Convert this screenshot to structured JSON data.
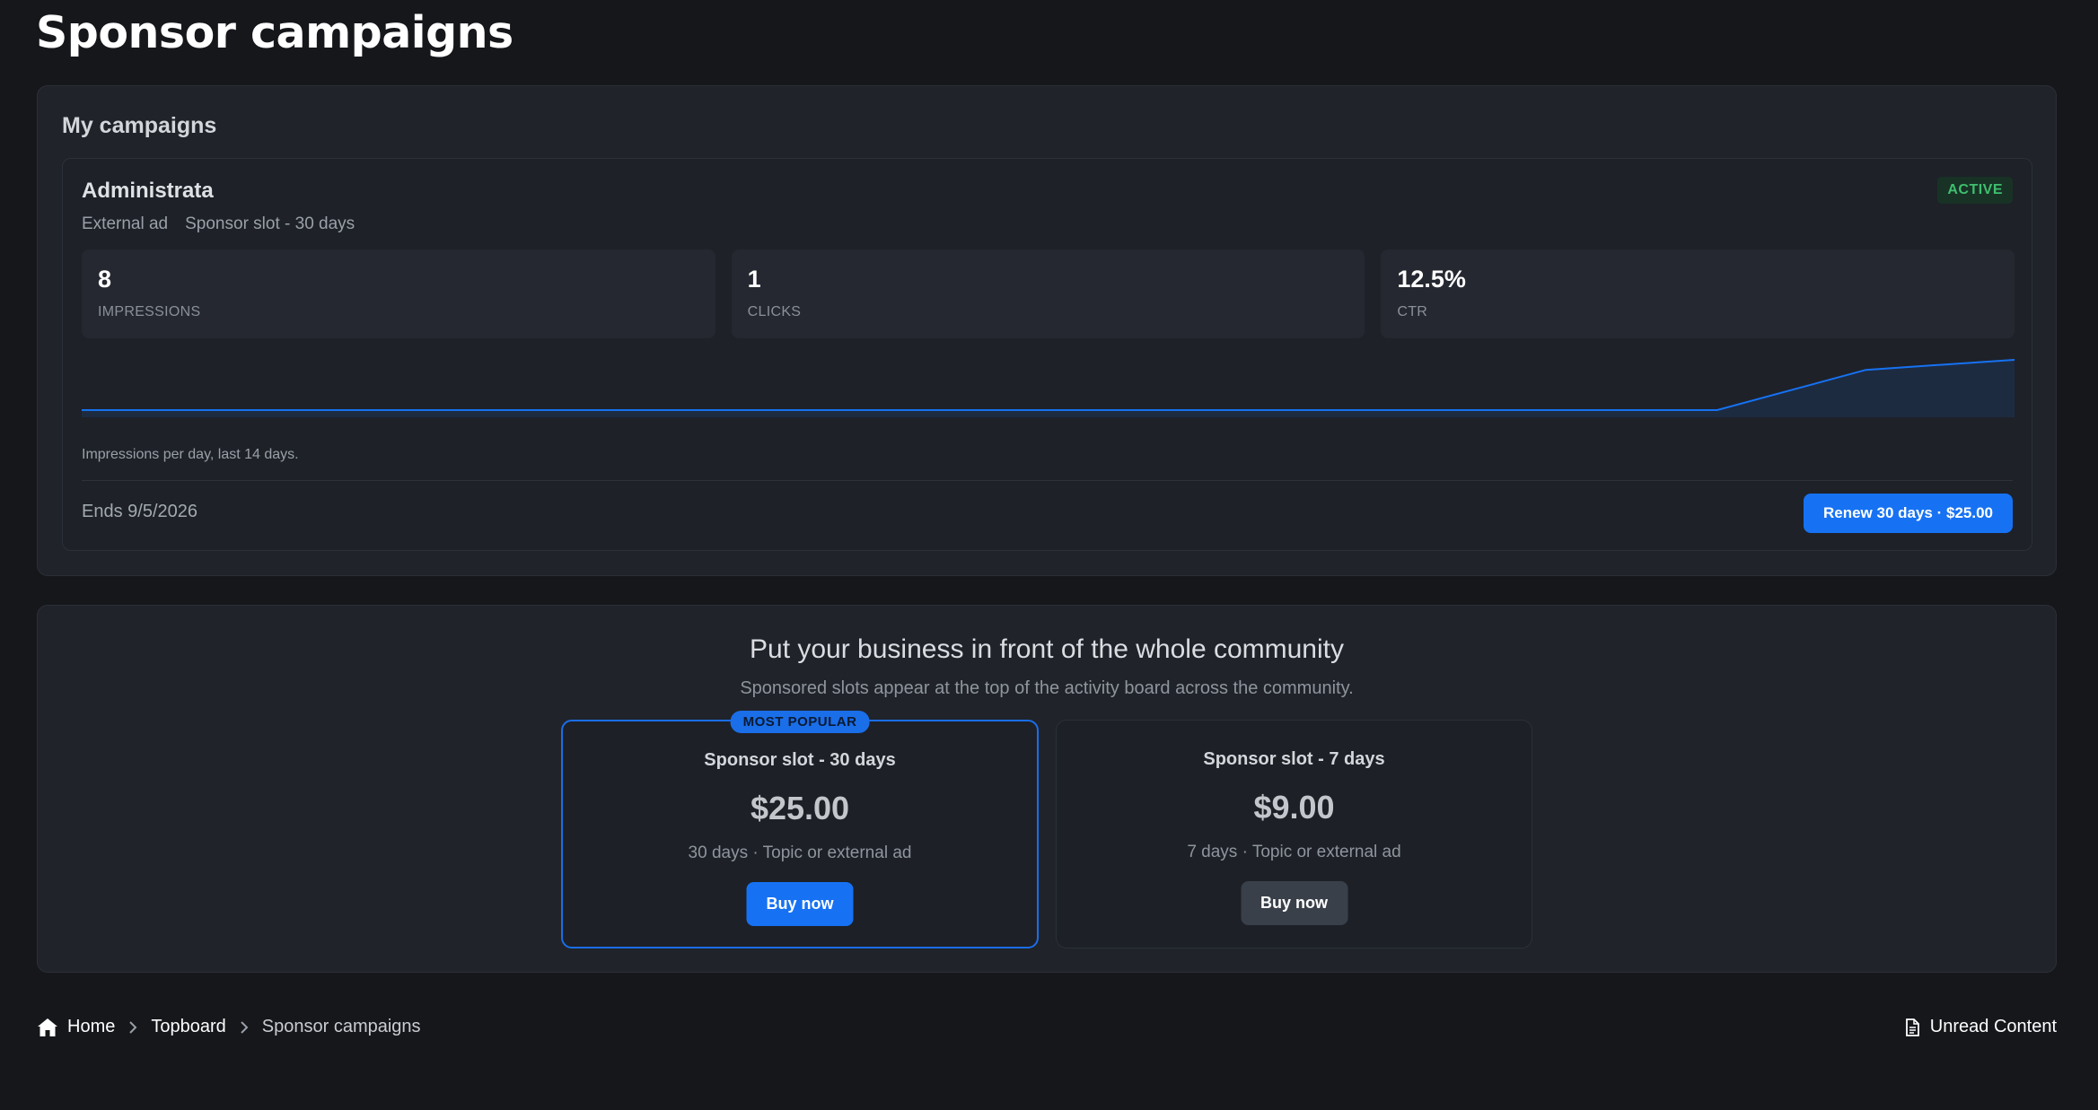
{
  "page": {
    "title": "Sponsor campaigns"
  },
  "campaigns": {
    "heading": "My campaigns",
    "card": {
      "name": "Administrata",
      "status": "ACTIVE",
      "meta": [
        "External ad",
        "Sponsor slot - 30 days"
      ],
      "stats": [
        {
          "value": "8",
          "label": "IMPRESSIONS"
        },
        {
          "value": "1",
          "label": "CLICKS"
        },
        {
          "value": "12.5%",
          "label": "CTR"
        }
      ],
      "chart_caption": "Impressions per day, last 14 days.",
      "ends": "Ends 9/5/2026",
      "renew_label": "Renew 30 days · $25.00"
    }
  },
  "chart_data": {
    "type": "area",
    "x": [
      1,
      2,
      3,
      4,
      5,
      6,
      7,
      8,
      9,
      10,
      11,
      12,
      13,
      14
    ],
    "series": [
      {
        "values": [
          0,
          0,
          0,
          0,
          0,
          0,
          0,
          0,
          0,
          0,
          0,
          0,
          4,
          5
        ]
      }
    ],
    "ylim": [
      0,
      5
    ],
    "grid": false,
    "color": "#1672f3"
  },
  "promo": {
    "title": "Put your business in front of the whole community",
    "subtitle": "Sponsored slots appear at the top of the activity board across the community.",
    "plans": [
      {
        "badge": "MOST POPULAR",
        "name": "Sponsor slot - 30 days",
        "price": "$25.00",
        "desc": "30 days · Topic or external ad",
        "button": "Buy now"
      },
      {
        "name": "Sponsor slot - 7 days",
        "price": "$9.00",
        "desc": "7 days · Topic or external ad",
        "button": "Buy now"
      }
    ]
  },
  "breadcrumb": {
    "items": [
      "Home",
      "Topboard",
      "Sponsor campaigns"
    ],
    "icon": "home-icon"
  },
  "footer": {
    "unread_label": "Unread Content",
    "icon": "document-icon"
  },
  "colors": {
    "accent": "#1672f3",
    "active_badge_text": "#3fbf6e",
    "active_badge_bg": "#183226",
    "background": "#15171b",
    "panel": "#20232a"
  }
}
